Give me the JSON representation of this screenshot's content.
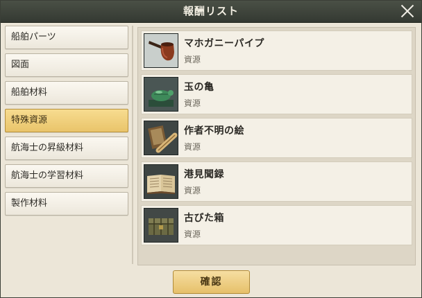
{
  "dialog": {
    "title": "報酬リスト"
  },
  "sidebar": {
    "items": [
      {
        "label": "船舶パーツ"
      },
      {
        "label": "図面"
      },
      {
        "label": "船舶材料"
      },
      {
        "label": "特殊資源",
        "selected": true
      },
      {
        "label": "航海士の昇級材料"
      },
      {
        "label": "航海士の学習材料"
      },
      {
        "label": "製作材料"
      }
    ]
  },
  "rewards": [
    {
      "name": "マホガニーパイプ",
      "type": "資源",
      "icon": "pipe-icon"
    },
    {
      "name": "玉の亀",
      "type": "資源",
      "icon": "jade-turtle-icon"
    },
    {
      "name": "作者不明の絵",
      "type": "資源",
      "icon": "painting-scroll-icon"
    },
    {
      "name": "港見聞録",
      "type": "資源",
      "icon": "book-icon"
    },
    {
      "name": "古びた箱",
      "type": "資源",
      "icon": "chest-icon"
    }
  ],
  "footer": {
    "confirm_label": "確認"
  },
  "colors": {
    "accent": "#e9c46a",
    "titlebar": "#3d4239",
    "panel": "#ece6d8"
  }
}
